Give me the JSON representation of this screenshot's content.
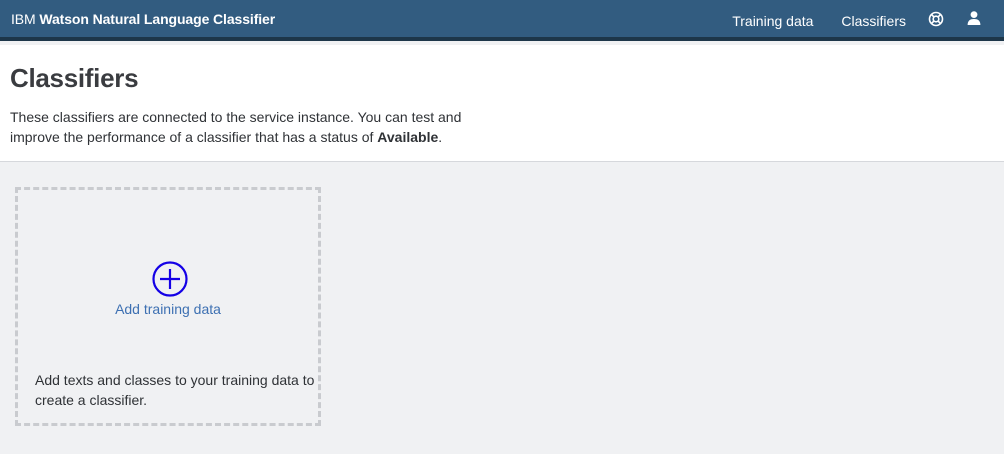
{
  "header": {
    "brand_prefix": "IBM",
    "brand_name": "Watson Natural Language Classifier",
    "nav_training": "Training data",
    "nav_classifiers": "Classifiers",
    "help_icon": "help-lifebuoy-icon",
    "user_icon": "user-icon",
    "colors": {
      "bar": "#325c80",
      "bar_border": "#1d3649"
    }
  },
  "page": {
    "title": "Classifiers",
    "desc_part1": "These classifiers are connected to the service instance. You can test and improve the performance of a classifier that has a status of ",
    "desc_bold": "Available",
    "desc_end": "."
  },
  "card": {
    "icon": "plus-circle-icon",
    "link": "Add training data",
    "text": "Add texts and classes to your training data to create a classifier.",
    "colors": {
      "plus": "#1400e6",
      "link": "#3d70b2"
    }
  }
}
